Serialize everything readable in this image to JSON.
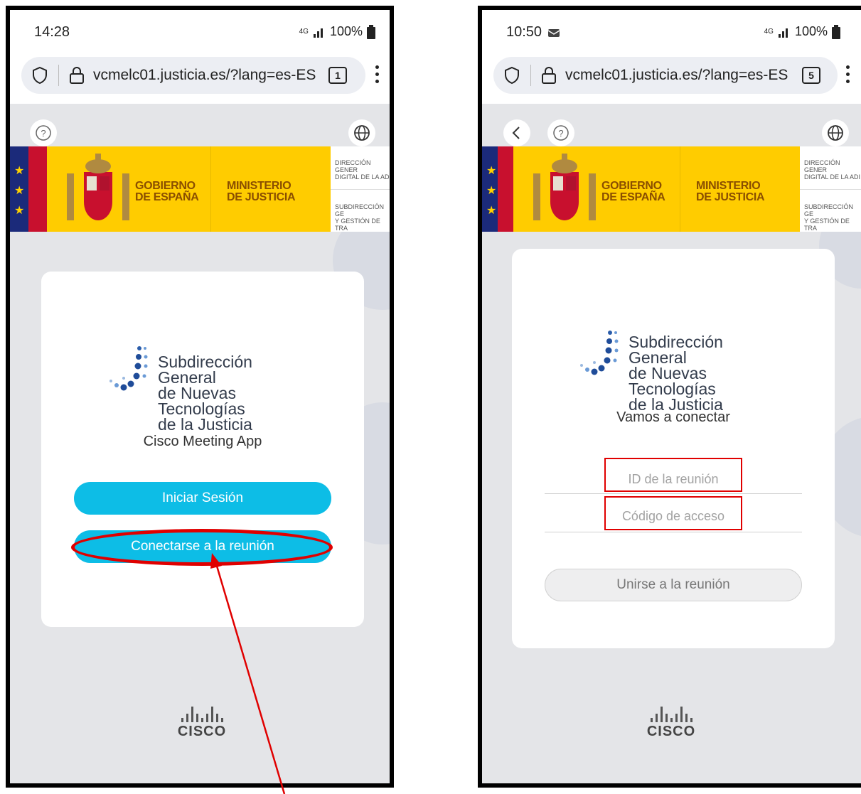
{
  "left_phone": {
    "status_time": "14:28",
    "status_signal": "4G",
    "status_battery": "100%",
    "url": "vcmelc01.justicia.es/?lang=es-ES",
    "tab_count": "1",
    "banner": {
      "gobierno": "GOBIERNO\nDE ESPAÑA",
      "ministerio": "MINISTERIO\nDE JUSTICIA",
      "side_top": "DIRECCIÓN GENER\nDIGITAL DE LA ADI",
      "side_bottom": "SUBDIRECCIÓN GE\nY GESTIÓN DE TRA"
    },
    "logo_text": "Subdirección General\nde Nuevas Tecnologías\nde la Justicia",
    "card_title": "Cisco Meeting App",
    "signin_label": "Iniciar Sesión",
    "join_label": "Conectarse a la reunión",
    "cisco_word": "CISCO"
  },
  "right_phone": {
    "status_time": "10:50",
    "status_signal": "4G",
    "status_battery": "100%",
    "url": "vcmelc01.justicia.es/?lang=es-ES",
    "tab_count": "5",
    "banner": {
      "gobierno": "GOBIERNO\nDE ESPAÑA",
      "ministerio": "MINISTERIO\nDE JUSTICIA",
      "side_top": "DIRECCIÓN GENER\nDIGITAL DE LA ADI",
      "side_bottom": "SUBDIRECCIÓN GE\nY GESTIÓN DE TRA"
    },
    "logo_text": "Subdirección General\nde Nuevas Tecnologías\nde la Justicia",
    "card_title": "Vamos a conectar",
    "meeting_id_placeholder": "ID de la reunión",
    "access_code_placeholder": "Código de acceso",
    "join_label": "Unirse a la reunión",
    "cisco_word": "CISCO"
  },
  "colors": {
    "accent_button": "#0dbde6",
    "annotation_red": "#e00000",
    "banner_yellow": "#ffcc00",
    "banner_text": "#8a4e00"
  },
  "icons": [
    "shield-icon",
    "lock-icon",
    "kebab-menu-icon",
    "help-icon",
    "globe-icon",
    "back-icon",
    "spain-coat-of-arms",
    "cisco-logo"
  ]
}
